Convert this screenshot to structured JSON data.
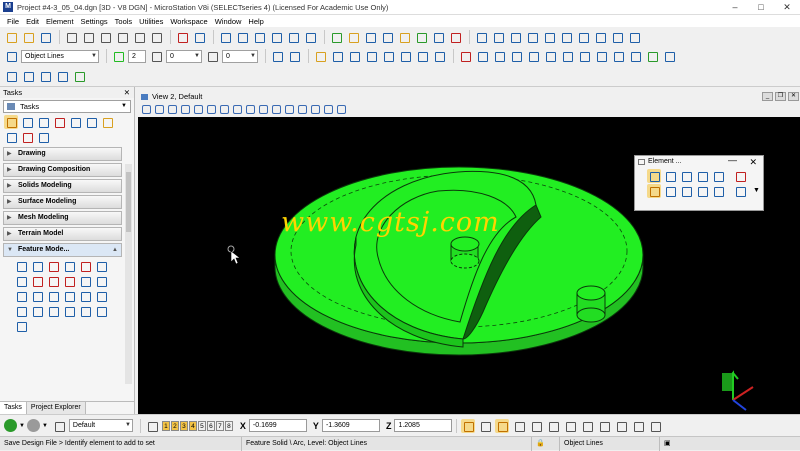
{
  "window": {
    "title": "Project #4-3_05_04.dgn [3D - V8 DGN] - MicroStation V8i (SELECTseries 4) (Licensed For Academic Use Only)",
    "controls": [
      "–",
      "□",
      "✕"
    ]
  },
  "menu": [
    "File",
    "Edit",
    "Element",
    "Settings",
    "Tools",
    "Utilities",
    "Workspace",
    "Window",
    "Help"
  ],
  "attributes": {
    "level": "Object Lines",
    "color_swatch": "#22bb22",
    "weight": "2",
    "style": "0",
    "class": "0"
  },
  "tasks": {
    "header": "Tasks",
    "selector": "Tasks",
    "groups": [
      "Drawing",
      "Drawing Composition",
      "Solids Modeling",
      "Surface Modeling",
      "Mesh Modeling",
      "Terrain Model"
    ],
    "active_group": "Feature Mode...",
    "tabs": [
      "Tasks",
      "Project Explorer"
    ]
  },
  "view": {
    "title": "View 2, Default",
    "watermark": "www.cgtsj.com"
  },
  "element_dialog": {
    "title": "Element ..."
  },
  "bottom": {
    "view_numbers": [
      "1",
      "2",
      "3",
      "4",
      "5",
      "6",
      "7",
      "8"
    ],
    "view_set": "Default",
    "x_label": "X",
    "x_value": "-0.1699",
    "y_label": "Y",
    "y_value": "-1.3609",
    "z_label": "Z",
    "z_value": "1.2085"
  },
  "status": {
    "prompt": "Save Design File > Identify element to add to set",
    "element_info": "Feature Solid \\ Arc, Level: Object Lines",
    "active_level": "Object Lines"
  },
  "colors": {
    "model_green": "#22ff22",
    "watermark_yellow": "#ffd400",
    "canvas": "#000000"
  }
}
